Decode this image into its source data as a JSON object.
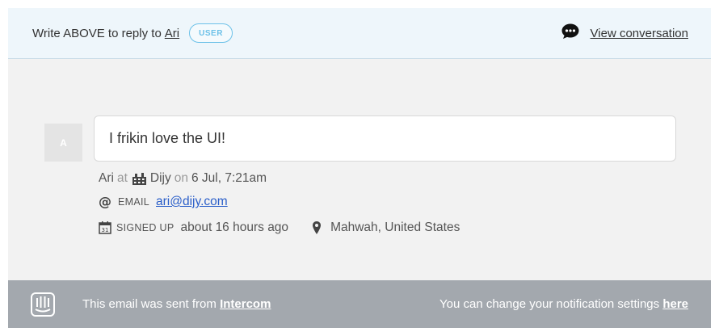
{
  "header": {
    "reply_text": "Write ABOVE to reply to",
    "reply_name": "Ari",
    "badge": "USER",
    "view_conversation": "View conversation"
  },
  "message": {
    "avatar_initial": "A",
    "text": "I frikin love the UI!",
    "author": "Ari",
    "at_word": "at",
    "company": "Dijy",
    "on_word": "on",
    "datetime": "6 Jul, 7:21am"
  },
  "user_info": {
    "email_label": "EMAIL",
    "email": "ari@dijy.com",
    "signed_up_label": "SIGNED UP",
    "signed_up_value": "about 16 hours ago",
    "location": "Mahwah, United States"
  },
  "footer": {
    "sent_text": "This email was sent from",
    "sent_link": "Intercom",
    "settings_text": "You can change your notification settings",
    "settings_link": "here"
  },
  "icons": {
    "chat": "chat-bubble-icon",
    "company": "building-icon",
    "email": "at-icon",
    "calendar": "calendar-icon",
    "location": "map-pin-icon",
    "logo": "intercom-logo-icon"
  },
  "colors": {
    "header_bg": "#eef6fb",
    "badge": "#6cc1e8",
    "body_bg": "#f2f2f2",
    "footer_bg": "#a3a8ae",
    "link": "#2a5ec9"
  }
}
